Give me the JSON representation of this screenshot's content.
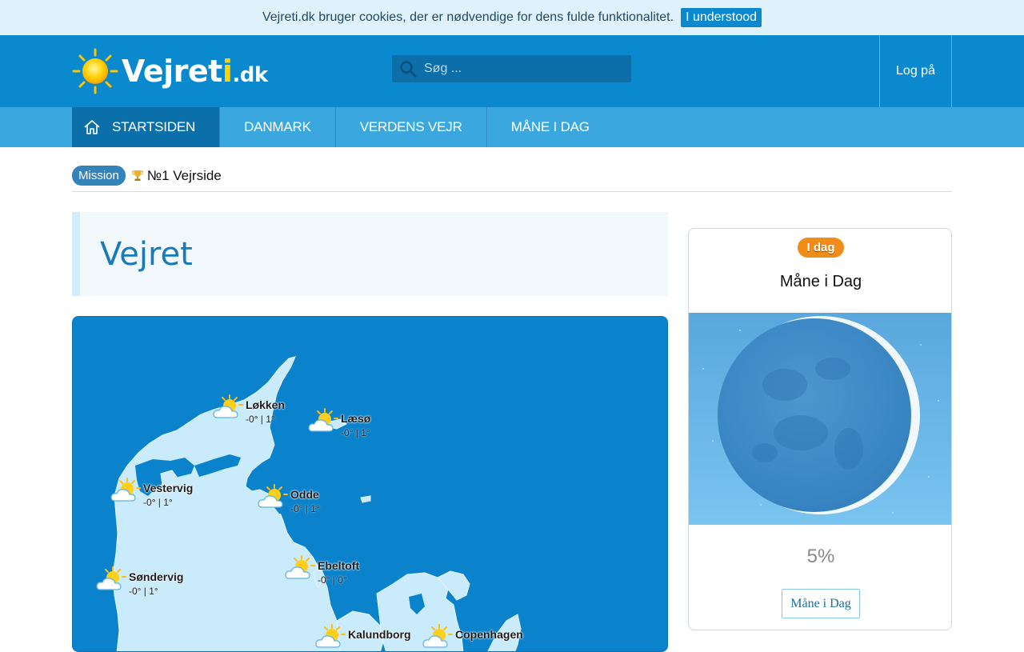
{
  "cookie": {
    "message": "Vejreti.dk bruger cookies, der er nødvendige for dens fulde funktionalitet.",
    "button": "I understood"
  },
  "header": {
    "logo_main": "Vejret",
    "logo_highlight": "i",
    "logo_suffix": ".dk",
    "search_placeholder": "Søg ...",
    "login": "Log på"
  },
  "nav": {
    "items": [
      {
        "label": "Startsiden",
        "icon": "home-icon",
        "active": true
      },
      {
        "label": "Danmark",
        "active": false
      },
      {
        "label": "Verdens vejr",
        "active": false
      },
      {
        "label": "Måne i dag",
        "active": false
      }
    ]
  },
  "breadcrumb": {
    "badge": "Mission",
    "tagline": "№1 Vejrside"
  },
  "page": {
    "title": "Vejret"
  },
  "map": {
    "cities": [
      {
        "name": "Løkken",
        "temp": "-0° | 1°",
        "icon": "partly-cloudy-icon"
      },
      {
        "name": "Læsø",
        "temp": "-0° | 1°",
        "icon": "partly-cloudy-icon"
      },
      {
        "name": "Vestervig",
        "temp": "-0° | 1°",
        "icon": "partly-cloudy-icon"
      },
      {
        "name": "Odde",
        "temp": "-0° | 1°",
        "icon": "partly-cloudy-icon"
      },
      {
        "name": "Søndervig",
        "temp": "-0° | 1°",
        "icon": "partly-cloudy-icon"
      },
      {
        "name": "Ebeltoft",
        "temp": "-0° | 0°",
        "icon": "partly-cloudy-icon"
      },
      {
        "name": "Kalundborg",
        "temp": "",
        "icon": "partly-cloudy-icon"
      },
      {
        "name": "Copenhagen",
        "temp": "",
        "icon": "partly-cloudy-icon"
      }
    ]
  },
  "moon": {
    "badge": "I dag",
    "title": "Måne i Dag",
    "percent": "5%",
    "illumination": 0.05,
    "button": "Måne i Dag"
  },
  "colors": {
    "primary": "#0a89cf",
    "nav": "#3aa8de",
    "nav_active": "#0b70aa",
    "accent_orange": "#f28c19",
    "logo_yellow": "#ffd200"
  }
}
